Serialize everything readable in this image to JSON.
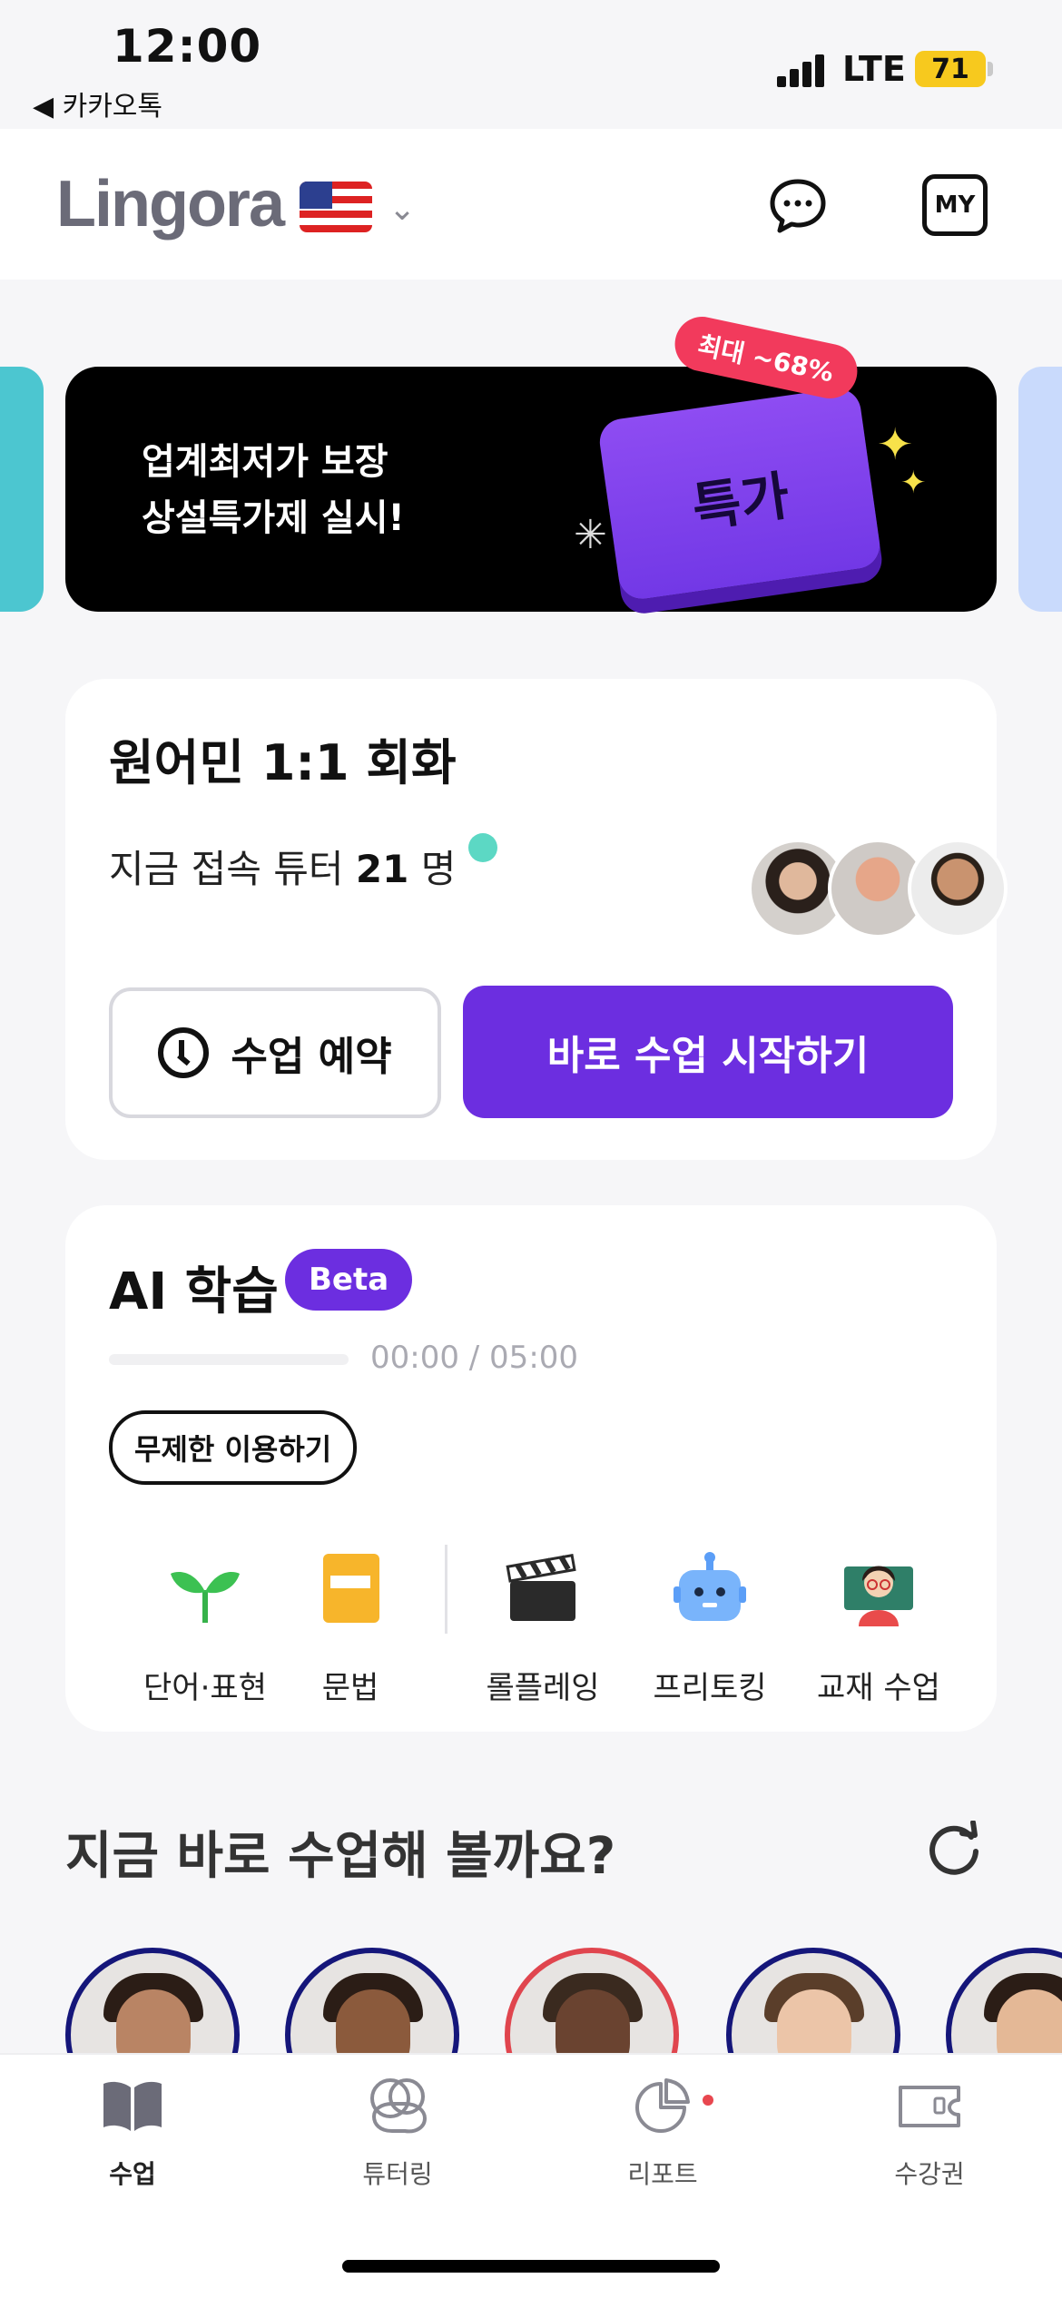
{
  "status_bar": {
    "time": "12:00",
    "back_app": "◀ 카카오톡",
    "network": "LTE",
    "battery": "71"
  },
  "header": {
    "logo": "Lingora",
    "language_flag": "us-flag-icon",
    "chevron": "⌄"
  },
  "banner": {
    "line1": "업계최저가 보장",
    "line2": "상설특가제 실시!",
    "card_label": "특가",
    "tag": "최대 ~68%"
  },
  "conversation": {
    "title": "원어민 1:1 회화",
    "online_prefix": "지금 접속 튜터",
    "online_count": "21",
    "online_suffix": "명",
    "reserve_label": "수업 예약",
    "start_label": "바로 수업 시작하기"
  },
  "ai_learning": {
    "title": "AI 학습",
    "badge": "Beta",
    "progress": 0,
    "timer": "00:00 / 05:00",
    "unlimited_label": "무제한 이용하기",
    "items": [
      {
        "label": "단어·표현",
        "icon": "sprout-icon"
      },
      {
        "label": "문법",
        "icon": "book-icon"
      },
      {
        "label": "롤플레잉",
        "icon": "clapperboard-icon"
      },
      {
        "label": "프리토킹",
        "icon": "robot-icon"
      },
      {
        "label": "교재 수업",
        "icon": "teacher-icon"
      }
    ]
  },
  "tutors_section": {
    "title": "지금 바로 수업해 볼까요?"
  },
  "bottom_nav": [
    {
      "label": "수업",
      "icon": "book-open-icon"
    },
    {
      "label": "튜터링",
      "icon": "chat-bubbles-icon"
    },
    {
      "label": "리포트",
      "icon": "pie-chart-icon"
    },
    {
      "label": "수강권",
      "icon": "ticket-icon"
    }
  ],
  "colors": {
    "primary": "#6c2ee0",
    "online": "#5cd8c4",
    "badge_red": "#f23a5c"
  }
}
